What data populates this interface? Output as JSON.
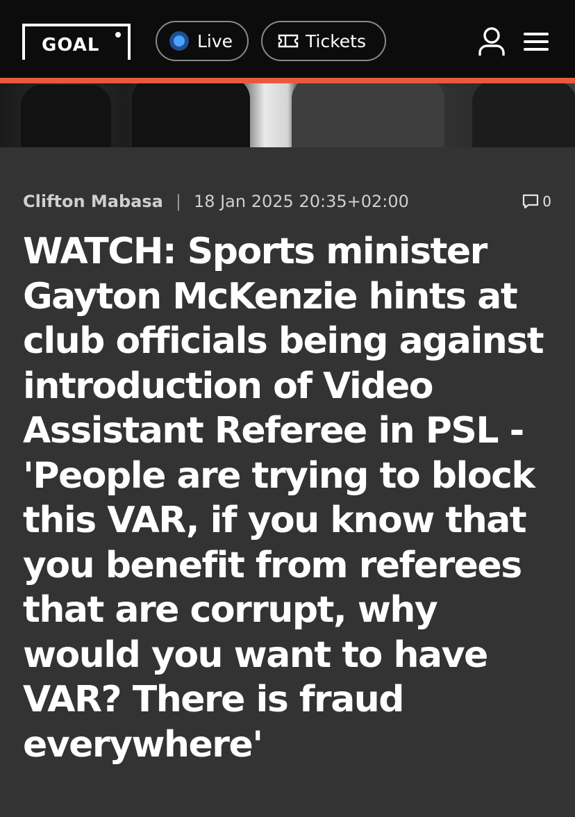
{
  "header": {
    "logo_text": "GOAL",
    "live_label": "Live",
    "tickets_label": "Tickets",
    "accent_color": "#e85a3c",
    "live_dot_color": "#4aa3ff"
  },
  "article": {
    "author": "Clifton Mabasa",
    "separator": "|",
    "date": "18 Jan 2025 20:35+02:00",
    "comment_count": "0",
    "headline": "WATCH: Sports minister Gayton McKenzie hints at club officials being against introduction of Video Assistant Referee in PSL - 'People are trying to block this VAR, if you know that you benefit from referees that are corrupt, why would you want to have VAR? There is fraud everywhere'"
  },
  "icons": {
    "user": "user-icon",
    "menu": "hamburger-menu-icon",
    "ticket": "ticket-icon",
    "comment": "comment-icon"
  }
}
